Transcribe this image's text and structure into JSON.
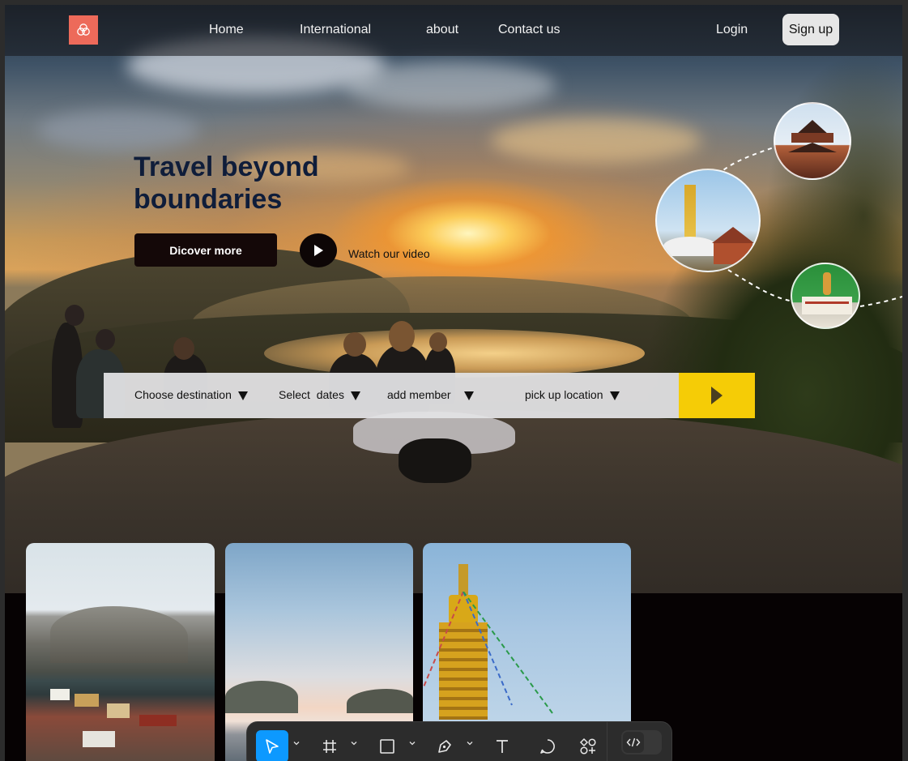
{
  "nav": {
    "links": [
      "Home",
      "International",
      "about",
      "Contact us"
    ],
    "login": "Login",
    "signup": "Sign up",
    "logo_icon": "venn-logo-icon"
  },
  "hero": {
    "headline": "Travel beyond boundaries",
    "cta": "Dicover more",
    "video_label": "Watch our video"
  },
  "search": {
    "fields": [
      "Choose destination",
      "Select  dates",
      "add member",
      "pick up location"
    ],
    "submit_icon": "play-arrow-icon"
  },
  "destinations": {
    "bubbles": [
      "pagoda-temple-photo",
      "stupa-photo",
      "statue-temple-photo"
    ],
    "cards": [
      "mountain-village-photo",
      "coast-sky-photo",
      "stupa-tower-photo"
    ]
  },
  "toolbar": {
    "tools": [
      "move-tool",
      "frame-tool",
      "rectangle-tool",
      "pen-tool",
      "text-tool",
      "comment-tool",
      "assets-tool",
      "dev-mode-toggle"
    ]
  },
  "colors": {
    "accent": "#ed6a5a",
    "headline": "#0f1d3a",
    "search_go": "#f5cc06",
    "tool_active": "#0d99ff"
  }
}
